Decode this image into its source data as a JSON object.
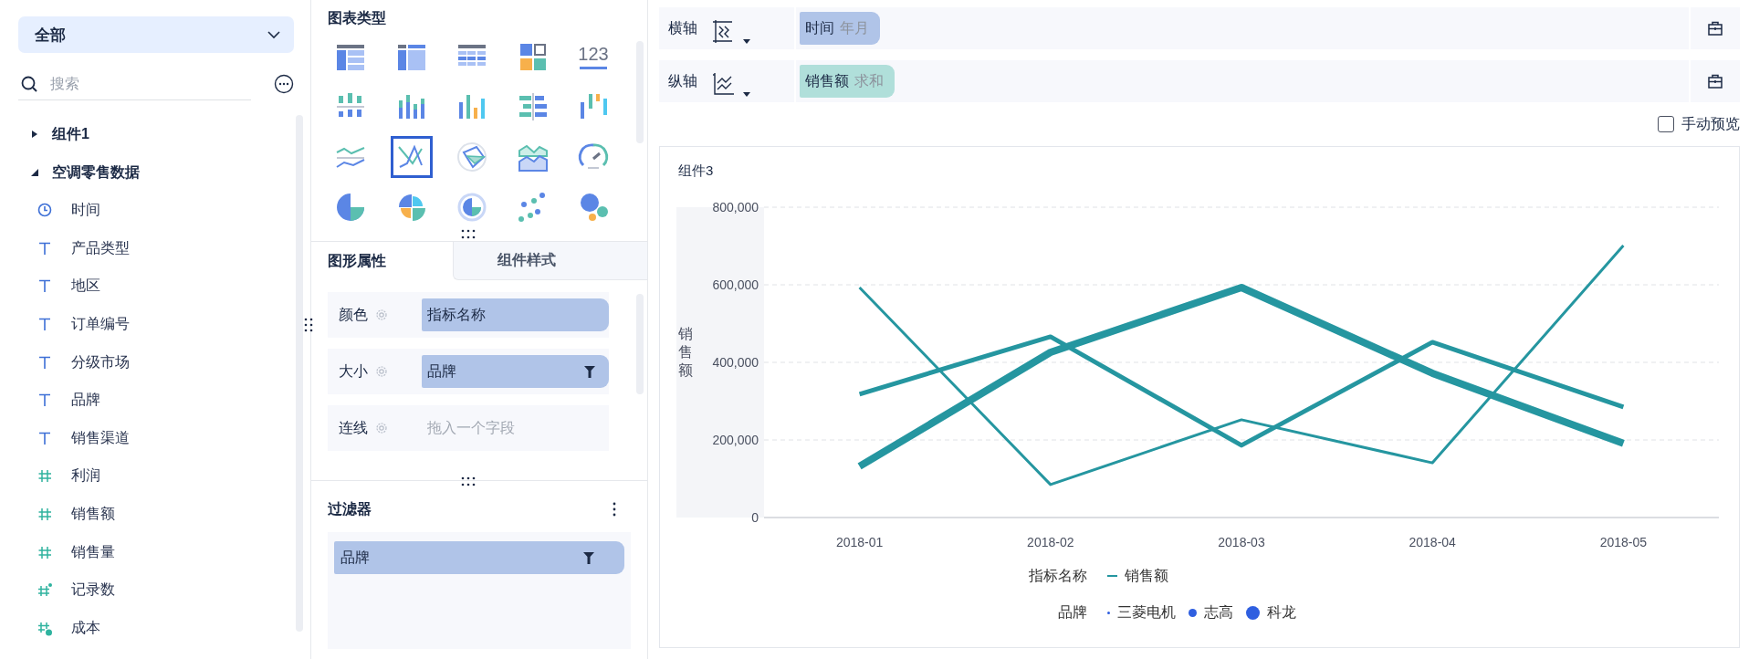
{
  "field_panel": {
    "dropdown": {
      "value": "全部"
    },
    "search": {
      "placeholder": "搜索"
    },
    "tree": [
      {
        "label": "组件1",
        "expanded": false
      },
      {
        "label": "空调零售数据",
        "expanded": true,
        "children": [
          {
            "label": "时间",
            "kind": "date"
          },
          {
            "label": "产品类型",
            "kind": "text"
          },
          {
            "label": "地区",
            "kind": "text"
          },
          {
            "label": "订单编号",
            "kind": "text"
          },
          {
            "label": "分级市场",
            "kind": "text"
          },
          {
            "label": "品牌",
            "kind": "text"
          },
          {
            "label": "销售渠道",
            "kind": "text"
          },
          {
            "label": "利润",
            "kind": "number"
          },
          {
            "label": "销售额",
            "kind": "number"
          },
          {
            "label": "销售量",
            "kind": "number"
          },
          {
            "label": "记录数",
            "kind": "count"
          },
          {
            "label": "成本",
            "kind": "calc"
          }
        ]
      }
    ]
  },
  "chart_panel": {
    "title": "图表类型",
    "chart_types": [
      {
        "kind": "group-table",
        "selected": false
      },
      {
        "kind": "cross-table",
        "selected": false
      },
      {
        "kind": "detail-table",
        "selected": false
      },
      {
        "kind": "block-grid",
        "selected": false
      },
      {
        "kind": "kpi",
        "text": "123",
        "selected": false
      },
      {
        "kind": "pos-neg-column",
        "selected": false
      },
      {
        "kind": "stacked-column",
        "selected": false
      },
      {
        "kind": "multi-column",
        "selected": false
      },
      {
        "kind": "bar-compare",
        "selected": false
      },
      {
        "kind": "range-column",
        "selected": false
      },
      {
        "kind": "multi-line",
        "selected": false
      },
      {
        "kind": "custom-line",
        "selected": true
      },
      {
        "kind": "radar",
        "selected": false
      },
      {
        "kind": "area",
        "selected": false
      },
      {
        "kind": "gauge",
        "selected": false
      },
      {
        "kind": "pie",
        "selected": false
      },
      {
        "kind": "quadrant-pie",
        "selected": false
      },
      {
        "kind": "ring",
        "selected": false
      },
      {
        "kind": "scatter",
        "selected": false
      },
      {
        "kind": "bubble",
        "selected": false
      }
    ]
  },
  "property_tabs": [
    {
      "label": "图形属性",
      "selected": true
    },
    {
      "label": "组件样式",
      "selected": false
    }
  ],
  "properties": [
    {
      "label": "颜色",
      "field": "指标名称",
      "filter": false
    },
    {
      "label": "大小",
      "field": "品牌",
      "filter": true
    },
    {
      "label": "连线",
      "placeholder": "拖入一个字段"
    }
  ],
  "filter": {
    "title": "过滤器",
    "items": [
      {
        "label": "品牌",
        "filter": true
      }
    ]
  },
  "axes": [
    {
      "label": "横轴",
      "kind": "x-axis",
      "field": "时间",
      "aggregation": "年月",
      "color": "#b0c4e8"
    },
    {
      "label": "纵轴",
      "kind": "y-axis",
      "field": "销售额",
      "aggregation": "求和",
      "color": "#b0dfda"
    }
  ],
  "manual_preview": {
    "label": "手动预览",
    "checked": false
  },
  "chart_card": {
    "title": "组件3",
    "chart_data": {
      "type": "line",
      "ylabel": "销售额",
      "categories": [
        "2018-01",
        "2018-02",
        "2018-03",
        "2018-04",
        "2018-05"
      ],
      "series": [
        {
          "name": "三菱电机",
          "color": "#2596a0",
          "values": [
            593000,
            85000,
            252000,
            141000,
            701000
          ]
        },
        {
          "name": "志高",
          "color": "#2596a0",
          "values": [
            318000,
            466000,
            186000,
            452000,
            285000
          ]
        },
        {
          "name": "科龙",
          "color": "#2596a0",
          "values": [
            132000,
            426000,
            593000,
            372000,
            191000
          ]
        }
      ],
      "ylim": [
        0,
        800000
      ],
      "grid": true,
      "yticks": [
        {
          "value": 0,
          "label": "0"
        },
        {
          "value": 200000,
          "label": "200,000"
        },
        {
          "value": 400000,
          "label": "400,000"
        },
        {
          "value": 600000,
          "label": "600,000"
        },
        {
          "value": 800000,
          "label": "800,000"
        }
      ]
    },
    "legend": [
      {
        "title": "指标名称",
        "entries": [
          {
            "label": "销售额",
            "kind": "line"
          }
        ]
      },
      {
        "title": "品牌",
        "kind": "series"
      }
    ]
  }
}
